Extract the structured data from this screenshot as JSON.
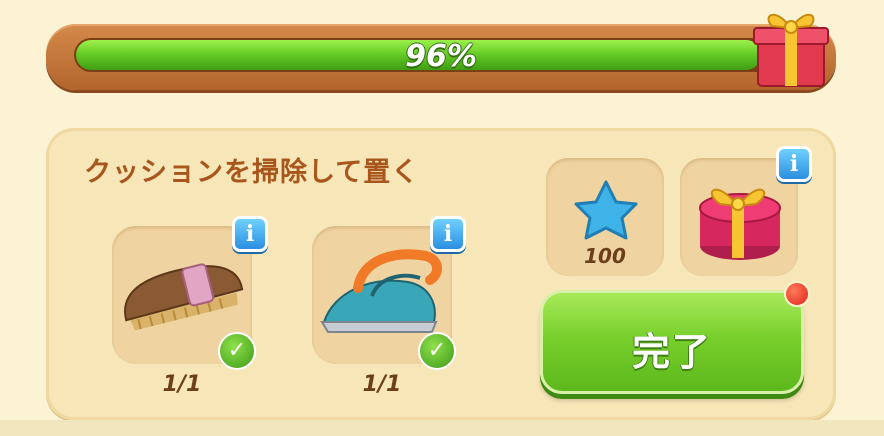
{
  "progress": {
    "label": "96%",
    "value": 0.96
  },
  "task": {
    "title": "クッションを掃除して置く",
    "requirements": [
      {
        "item": "brush",
        "count": "1/1",
        "completed": true
      },
      {
        "item": "iron",
        "count": "1/1",
        "completed": true
      }
    ]
  },
  "rewards": [
    {
      "type": "star",
      "amount": "100"
    },
    {
      "type": "gift-box"
    }
  ],
  "complete_button": {
    "label": "完了",
    "notification": true
  },
  "info_label": "i",
  "check_label": "✓",
  "colors": {
    "accent_green": "#6ccc26",
    "title_brown": "#a8561c",
    "info_blue": "#2a8fe0"
  }
}
